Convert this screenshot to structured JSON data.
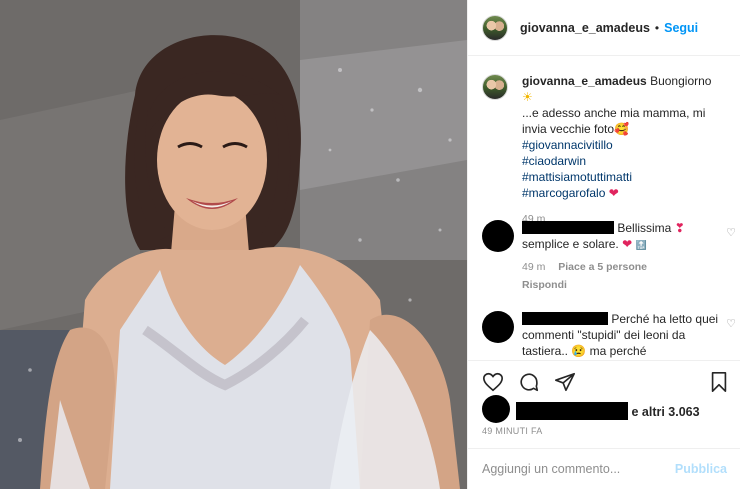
{
  "post": {
    "username": "giovanna_e_amadeus",
    "follow_label": "Segui",
    "dot": "•"
  },
  "caption": {
    "username": "giovanna_e_amadeus",
    "text_line1": "Buongiorno",
    "sun_emoji": "☀",
    "text_line2": "...e adesso anche mia mamma, mi invia vecchie foto",
    "emoji_love": "🥰",
    "hashtags": [
      "#giovannacivitillo",
      "#ciaodarwin",
      "#mattisiamotuttimatti",
      "#marcogarofalo"
    ],
    "heart": "❤",
    "age": "49 m"
  },
  "comments": [
    {
      "text": "Bellissima",
      "emoji1": "❣",
      "text2": "semplice e solare.",
      "emoji2": "❤",
      "emoji3": "🔝",
      "age": "49 m",
      "likes": "Piace a 5 persone",
      "reply": "Rispondi"
    },
    {
      "text": "Perché ha letto quei commenti \"stupidi\" dei leoni da tastiera..",
      "emoji": "😢",
      "text2": "ma perché"
    }
  ],
  "actions": {
    "like_icon": "heart-outline-icon",
    "comment_icon": "comment-icon",
    "share_icon": "share-icon",
    "save_icon": "bookmark-icon"
  },
  "likes": {
    "text": "e altri 3.063"
  },
  "time": "49 MINUTI FA",
  "add_comment": {
    "placeholder": "Aggiungi un commento...",
    "publish_label": "Pubblica"
  }
}
